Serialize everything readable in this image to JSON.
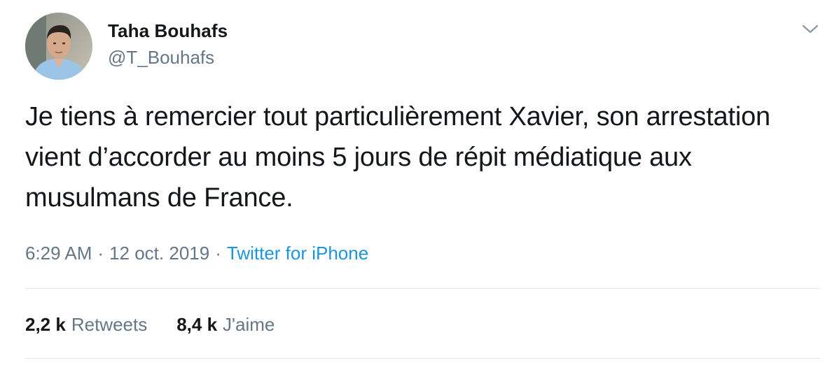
{
  "author": {
    "display_name": "Taha Bouhafs",
    "handle": "@T_Bouhafs",
    "avatar_icon": "profile-photo"
  },
  "menu_icon": "chevron-down-icon",
  "tweet": {
    "text": "Je tiens à remercier tout particulièrement Xavier, son arrestation vient d’accorder au moins 5 jours de répit médiatique aux musulmans de France."
  },
  "meta": {
    "time": "6:29 AM",
    "separator": "·",
    "date": "12 oct. 2019",
    "source": "Twitter for iPhone"
  },
  "stats": {
    "retweets_count": "2,2 k",
    "retweets_label": "Retweets",
    "likes_count": "8,4 k",
    "likes_label": "J'aime"
  },
  "colors": {
    "text": "#14171a",
    "secondary": "#657786",
    "link": "#1b95e0",
    "divider": "#e1e8ed"
  }
}
